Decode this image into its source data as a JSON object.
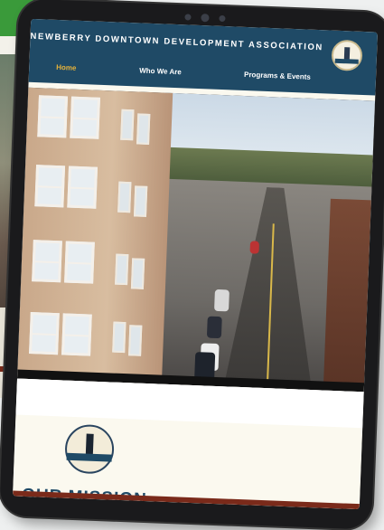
{
  "site": {
    "org_name": "NEWBERRY DOWNTOWN DEVELOPMENT ASSOCIATION"
  },
  "nav": {
    "items": [
      {
        "label": "Home",
        "active": true
      },
      {
        "label": "Who We Are",
        "active": false
      },
      {
        "label": "Programs & Events",
        "active": false
      }
    ]
  },
  "section": {
    "heading": "OUR MISSION"
  },
  "colors": {
    "nav_bg": "#1f4a66",
    "active_nav": "#e6b23a",
    "accent_bar": "#7a2a1a",
    "page_bg": "#fbf9ef"
  },
  "icons": {
    "logo": "clock-tower-logo",
    "emblem": "clock-tower-emblem"
  }
}
